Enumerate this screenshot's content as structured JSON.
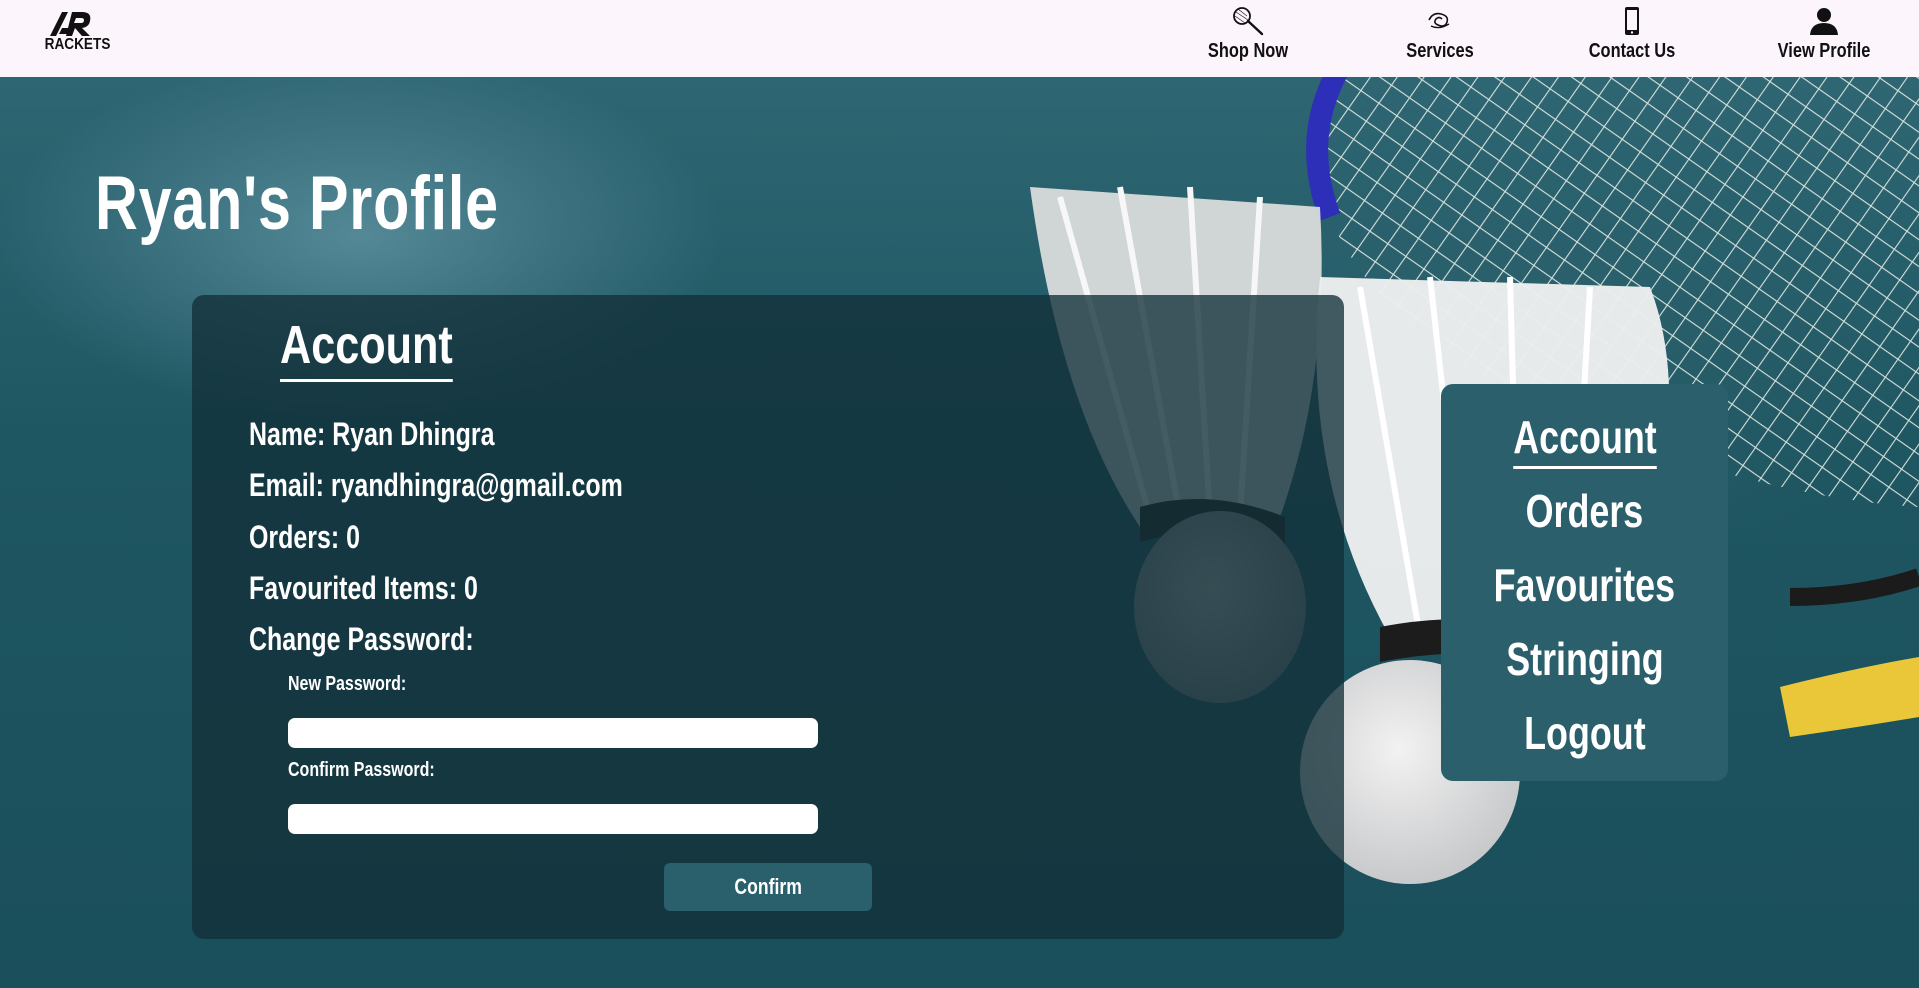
{
  "brand": {
    "logo_text": "RACKETS"
  },
  "nav": [
    {
      "label": "Shop Now",
      "icon": "racket-icon"
    },
    {
      "label": "Services",
      "icon": "services-icon"
    },
    {
      "label": "Contact Us",
      "icon": "phone-icon"
    },
    {
      "label": "View Profile",
      "icon": "user-icon"
    }
  ],
  "page": {
    "title": "Ryan's Profile"
  },
  "account": {
    "heading": "Account",
    "name": "Name: Ryan Dhingra",
    "email": "Email: ryandhingra@gmail.com",
    "orders": "Orders: 0",
    "favourites": "Favourited Items: 0",
    "change_password": "Change Password:",
    "new_password_label": "New Password:",
    "new_password_value": "",
    "confirm_password_label": "Confirm Password:",
    "confirm_password_value": "",
    "confirm_button": "Confirm"
  },
  "side_menu": [
    {
      "label": "Account",
      "active": true
    },
    {
      "label": "Orders",
      "active": false
    },
    {
      "label": "Favourites",
      "active": false
    },
    {
      "label": "Stringing",
      "active": false
    },
    {
      "label": "Logout",
      "active": false
    }
  ],
  "colors": {
    "topbar": "#fdf5fc",
    "panel": "#12303899",
    "side_menu": "#2a5f6b",
    "button": "#2a606c",
    "background": "#1f5661"
  }
}
